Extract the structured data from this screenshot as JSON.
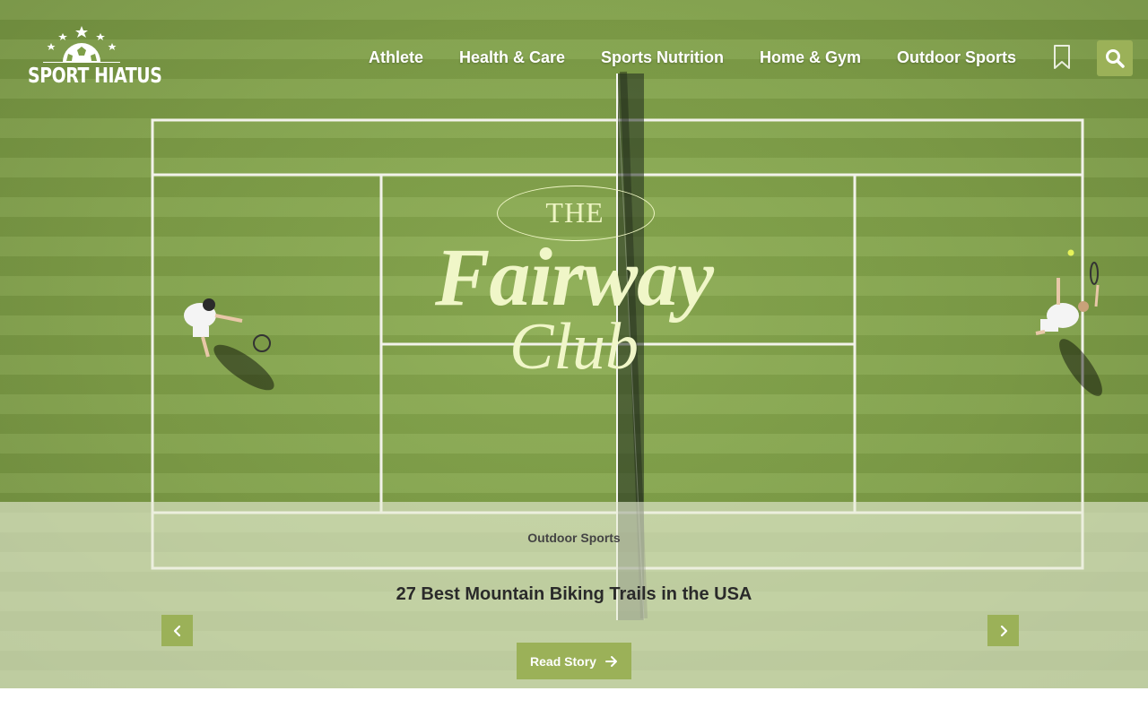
{
  "site": {
    "logo_text": "SPORT HIATUS"
  },
  "nav": {
    "items": [
      {
        "label": "Athlete"
      },
      {
        "label": "Health & Care"
      },
      {
        "label": "Sports Nutrition"
      },
      {
        "label": "Home & Gym"
      },
      {
        "label": "Outdoor Sports"
      }
    ],
    "bookmark_icon": "bookmark-icon",
    "search_icon": "search-icon"
  },
  "hero": {
    "brand_the": "THE",
    "brand_fairway": "Fairway",
    "brand_club": "Club",
    "category": "Outdoor Sports",
    "title": "27 Best Mountain Biking Trails in the USA",
    "read_button": "Read Story",
    "prev_icon": "chevron-left-icon",
    "next_icon": "chevron-right-icon"
  },
  "colors": {
    "accent": "#9bb158",
    "grass": "#7f9f48",
    "brand_text": "#f0f6c8",
    "overlay": "#e8eed6"
  }
}
